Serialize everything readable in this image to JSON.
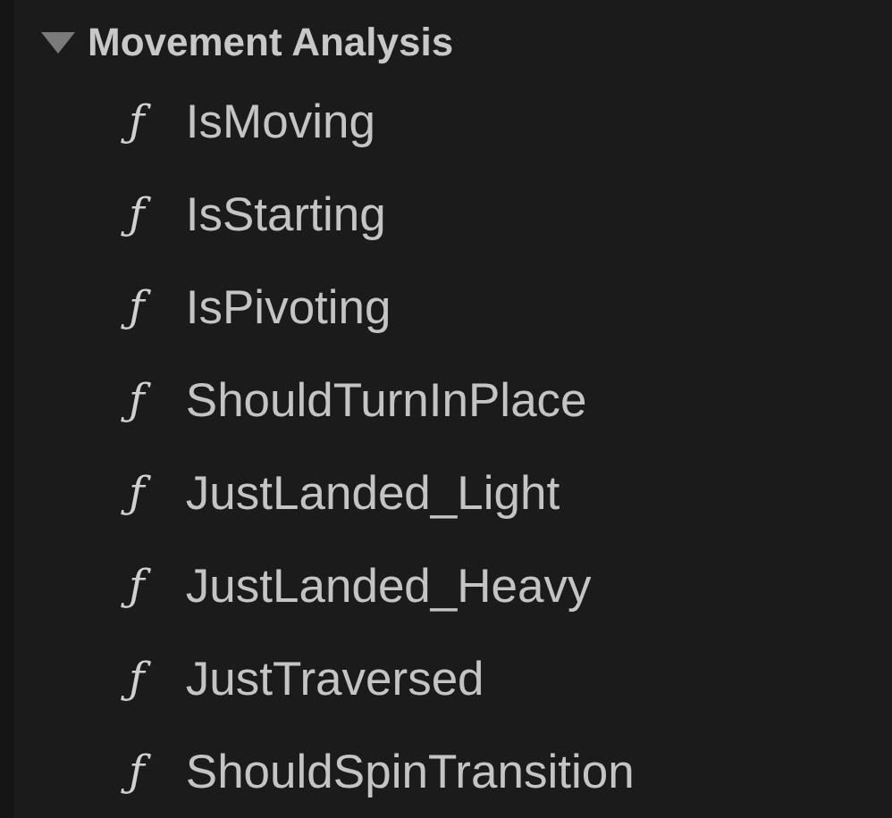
{
  "category": {
    "label": "Movement Analysis",
    "expanded": true,
    "items": [
      {
        "icon": "ƒ",
        "label": "IsMoving"
      },
      {
        "icon": "ƒ",
        "label": "IsStarting"
      },
      {
        "icon": "ƒ",
        "label": "IsPivoting"
      },
      {
        "icon": "ƒ",
        "label": "ShouldTurnInPlace"
      },
      {
        "icon": "ƒ",
        "label": "JustLanded_Light"
      },
      {
        "icon": "ƒ",
        "label": "JustLanded_Heavy"
      },
      {
        "icon": "ƒ",
        "label": "JustTraversed"
      },
      {
        "icon": "ƒ",
        "label": "ShouldSpinTransition"
      }
    ]
  }
}
